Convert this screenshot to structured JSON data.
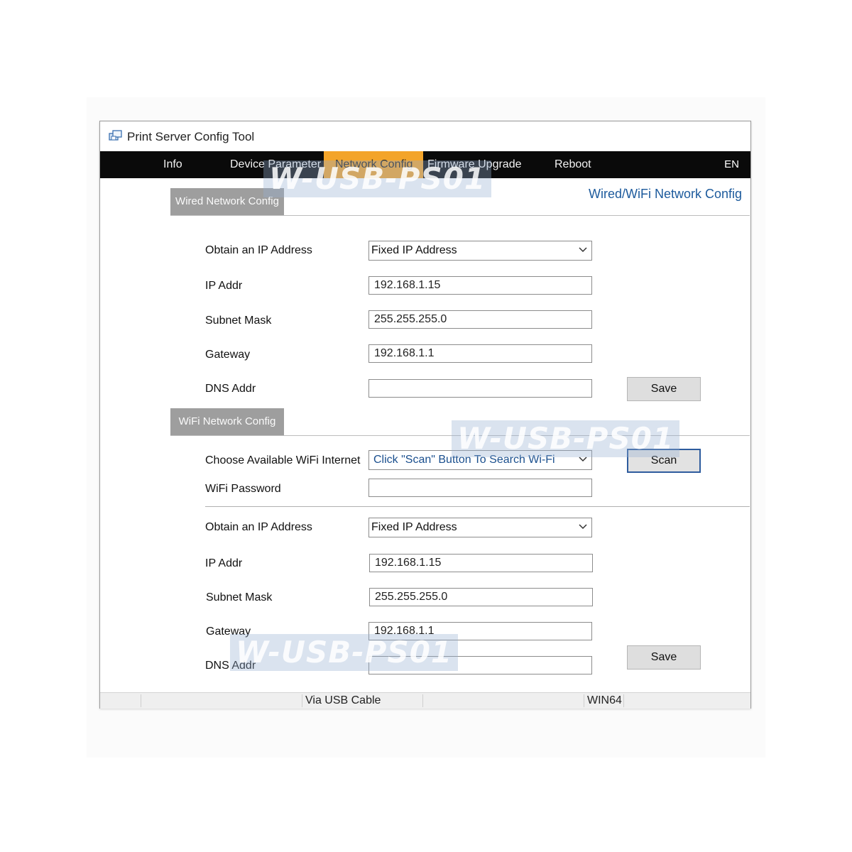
{
  "window": {
    "title": "Print Server Config Tool"
  },
  "menu": {
    "items": [
      "Info",
      "Device Parameter",
      "Network Config",
      "Firmware Upgrade",
      "Reboot"
    ],
    "active": "Network Config",
    "language": "EN"
  },
  "page_heading": "Wired/WiFi Network Config",
  "wired": {
    "tab_label": "Wired Network Config",
    "obtain_ip_label": "Obtain an IP Address",
    "obtain_ip_value": "Fixed IP Address",
    "ip_label": "IP Addr",
    "ip_value": "192.168.1.15",
    "subnet_label": "Subnet Mask",
    "subnet_value": "255.255.255.0",
    "gateway_label": "Gateway",
    "gateway_value": "192.168.1.1",
    "dns_label": "DNS Addr",
    "dns_value": "",
    "save_label": "Save"
  },
  "wifi": {
    "tab_label": "WiFi Network Config",
    "choose_label": "Choose Available WiFi Internet",
    "choose_value": "Click \"Scan\" Button To Search Wi-Fi",
    "scan_label": "Scan",
    "password_label": "WiFi Password",
    "password_value": "",
    "obtain_ip_label": "Obtain an IP Address",
    "obtain_ip_value": "Fixed IP Address",
    "ip_label": "IP Addr",
    "ip_value": "192.168.1.15",
    "subnet_label": "Subnet Mask",
    "subnet_value": "255.255.255.0",
    "gateway_label": "Gateway",
    "gateway_value": "192.168.1.1",
    "dns_label": "DNS Addr",
    "dns_value": "",
    "save_label": "Save"
  },
  "statusbar": {
    "connection": "Via USB Cable",
    "platform": "WIN64"
  },
  "watermark": "W-USB-PS01",
  "colors": {
    "menu_bg": "#0a0a0a",
    "active_tab": "#f3a42a",
    "section_tab": "#9e9e9e",
    "heading": "#1c5a9c",
    "focus_border": "#2e5c9e"
  }
}
